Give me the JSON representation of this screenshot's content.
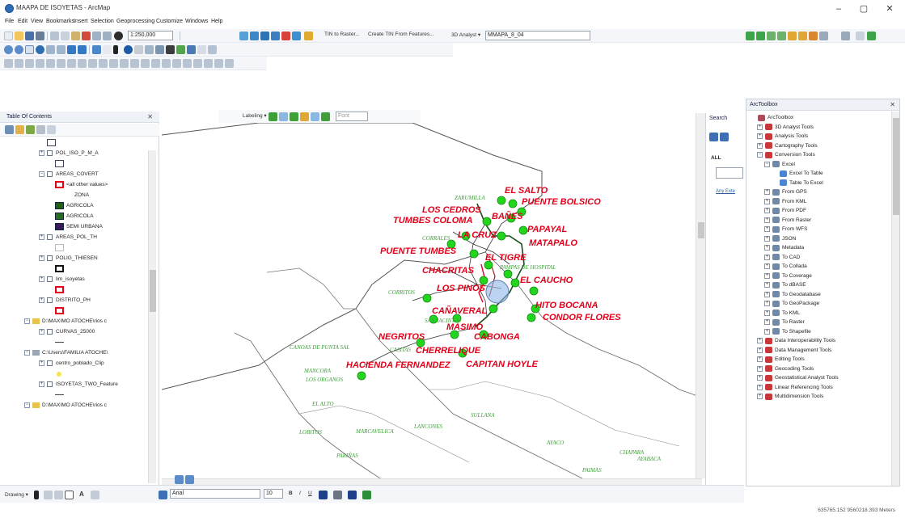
{
  "window": {
    "title": "MAAPA DE ISOYETAS - ArcMap",
    "minimize": "–",
    "maximize": "▢",
    "close": "✕"
  },
  "menu": [
    "File",
    "Edit",
    "View",
    "Bookmarks",
    "Insert",
    "Selection",
    "Geoprocessing",
    "Customize",
    "Windows",
    "Help"
  ],
  "toolbar": {
    "scale": "1:250,000",
    "tin_to_raster": "TIN to Raster...",
    "create_tin": "Create TIN From Features...",
    "analyst_3d": "3D Analyst ▾",
    "layer_select": "MMAPA_8_04",
    "labeling": "Labeling ▾",
    "font_box": "Font"
  },
  "toc": {
    "title": "Table Of Contents",
    "pin": "✕",
    "items": [
      {
        "label": "POL_ISO_P_M_A",
        "level": 1,
        "expand": "+"
      },
      {
        "label": "AREAS_COVERT",
        "level": 1,
        "expand": "−"
      },
      {
        "label": "<all other values>",
        "level": 2
      },
      {
        "label": "ZONA",
        "level": 2
      },
      {
        "label": "AGRICOLA",
        "level": 2
      },
      {
        "label": "AGRICOLA",
        "level": 2
      },
      {
        "label": "SEMI URBANA",
        "level": 2
      },
      {
        "label": "AREAS_POL_TH",
        "level": 1,
        "expand": "+"
      },
      {
        "label": "POLIG_THIESEN",
        "level": 1,
        "expand": "+"
      },
      {
        "label": "lim_isoyetas",
        "level": 1,
        "expand": "+"
      },
      {
        "label": "DISTRITO_PH",
        "level": 1,
        "expand": "+"
      },
      {
        "label": "D:\\MAXIMO ATOCHE\\rios c",
        "level": 0,
        "expand": "−"
      },
      {
        "label": "CURVAS_25000",
        "level": 1,
        "expand": "+"
      },
      {
        "label": "C:\\Users\\FAMILIA ATOCHE\\",
        "level": 0,
        "expand": "−"
      },
      {
        "label": "centro_poblado_Clip",
        "level": 1,
        "expand": "+"
      },
      {
        "label": "ISOYETAS_TWO_Feature",
        "level": 1,
        "expand": "+"
      },
      {
        "label": "D:\\MAXIMO ATOCHE\\rios c",
        "level": 0,
        "expand": "−"
      }
    ]
  },
  "search": {
    "title": "Search",
    "all": "ALL",
    "any_extent": "Any Exte"
  },
  "toolbox": {
    "title": "ArcToolbox",
    "close": "✕",
    "items": [
      {
        "label": "ArcToolbox",
        "level": 0,
        "type": "root"
      },
      {
        "label": "3D Analyst Tools",
        "level": 1,
        "type": "box",
        "expand": "+"
      },
      {
        "label": "Analysis Tools",
        "level": 1,
        "type": "box",
        "expand": "+"
      },
      {
        "label": "Cartography Tools",
        "level": 1,
        "type": "box",
        "expand": "+"
      },
      {
        "label": "Conversion Tools",
        "level": 1,
        "type": "box",
        "expand": "−"
      },
      {
        "label": "Excel",
        "level": 2,
        "type": "set",
        "expand": "−"
      },
      {
        "label": "Excel To Table",
        "level": 3,
        "type": "tool"
      },
      {
        "label": "Table To Excel",
        "level": 3,
        "type": "tool"
      },
      {
        "label": "From GPS",
        "level": 2,
        "type": "set",
        "expand": "+"
      },
      {
        "label": "From KML",
        "level": 2,
        "type": "set",
        "expand": "+"
      },
      {
        "label": "From PDF",
        "level": 2,
        "type": "set",
        "expand": "+"
      },
      {
        "label": "From Raster",
        "level": 2,
        "type": "set",
        "expand": "+"
      },
      {
        "label": "From WFS",
        "level": 2,
        "type": "set",
        "expand": "+"
      },
      {
        "label": "JSON",
        "level": 2,
        "type": "set",
        "expand": "+"
      },
      {
        "label": "Metadata",
        "level": 2,
        "type": "set",
        "expand": "+"
      },
      {
        "label": "To CAD",
        "level": 2,
        "type": "set",
        "expand": "+"
      },
      {
        "label": "To Collada",
        "level": 2,
        "type": "set",
        "expand": "+"
      },
      {
        "label": "To Coverage",
        "level": 2,
        "type": "set",
        "expand": "+"
      },
      {
        "label": "To dBASE",
        "level": 2,
        "type": "set",
        "expand": "+"
      },
      {
        "label": "To Geodatabase",
        "level": 2,
        "type": "set",
        "expand": "+"
      },
      {
        "label": "To GeoPackage",
        "level": 2,
        "type": "set",
        "expand": "+"
      },
      {
        "label": "To KML",
        "level": 2,
        "type": "set",
        "expand": "+"
      },
      {
        "label": "To Raster",
        "level": 2,
        "type": "set",
        "expand": "+"
      },
      {
        "label": "To Shapefile",
        "level": 2,
        "type": "set",
        "expand": "+"
      },
      {
        "label": "Data Interoperability Tools",
        "level": 1,
        "type": "box",
        "expand": "+"
      },
      {
        "label": "Data Management Tools",
        "level": 1,
        "type": "box",
        "expand": "+"
      },
      {
        "label": "Editing Tools",
        "level": 1,
        "type": "box",
        "expand": "+"
      },
      {
        "label": "Geocoding Tools",
        "level": 1,
        "type": "box",
        "expand": "+"
      },
      {
        "label": "Geostatistical Analyst Tools",
        "level": 1,
        "type": "box",
        "expand": "+"
      },
      {
        "label": "Linear Referencing Tools",
        "level": 1,
        "type": "box",
        "expand": "+"
      },
      {
        "label": "Multidimension Tools",
        "level": 1,
        "type": "box",
        "expand": "+"
      }
    ]
  },
  "map": {
    "red_labels": [
      "EL SALTO",
      "PUENTE BOLSICO",
      "LOS CEDROS",
      "TUMBES COLOMA",
      "BAÑES",
      "PAPAYAL",
      "LA CRUZ",
      "MATAPALO",
      "PUENTE TUMBES",
      "EL TIGRE",
      "CHACRITAS",
      "EL CAUCHO",
      "LOS PINOS",
      "HITO BOCANA",
      "CAÑAVERAL",
      "CONDOR FLORES",
      "NEGRITOS",
      "MASIMO",
      "CABONGA",
      "CHERRELIQUE",
      "HACIENDA FERNANDEZ",
      "CAPITAN HOYLE"
    ],
    "green_labels": [
      "ZARUMILLA",
      "CORRALES",
      "PAMPAS DE HOSPITAL",
      "CORRITOS",
      "SAN JACINTO",
      "CANOAS DE PUNTA SAL",
      "CASITAS",
      "MANCORA",
      "LOS ORGANOS",
      "EL ALTO",
      "LOBITOS",
      "MARCAVELICA",
      "LANCONES",
      "SULLANA",
      "PARIÑAS",
      "AYACO",
      "CHAPARA",
      "AYABACA",
      "PAIMAS"
    ]
  },
  "bottom": {
    "drawing": "Drawing ▾",
    "font_name": "Arial",
    "font_size": "10"
  },
  "status": {
    "coords": "635765.152  9560218.393 Meters"
  },
  "colors": {
    "label_red": "#e3001b",
    "label_green": "#3fa03a",
    "point_green": "#22d61e",
    "boundary": "#555555"
  }
}
